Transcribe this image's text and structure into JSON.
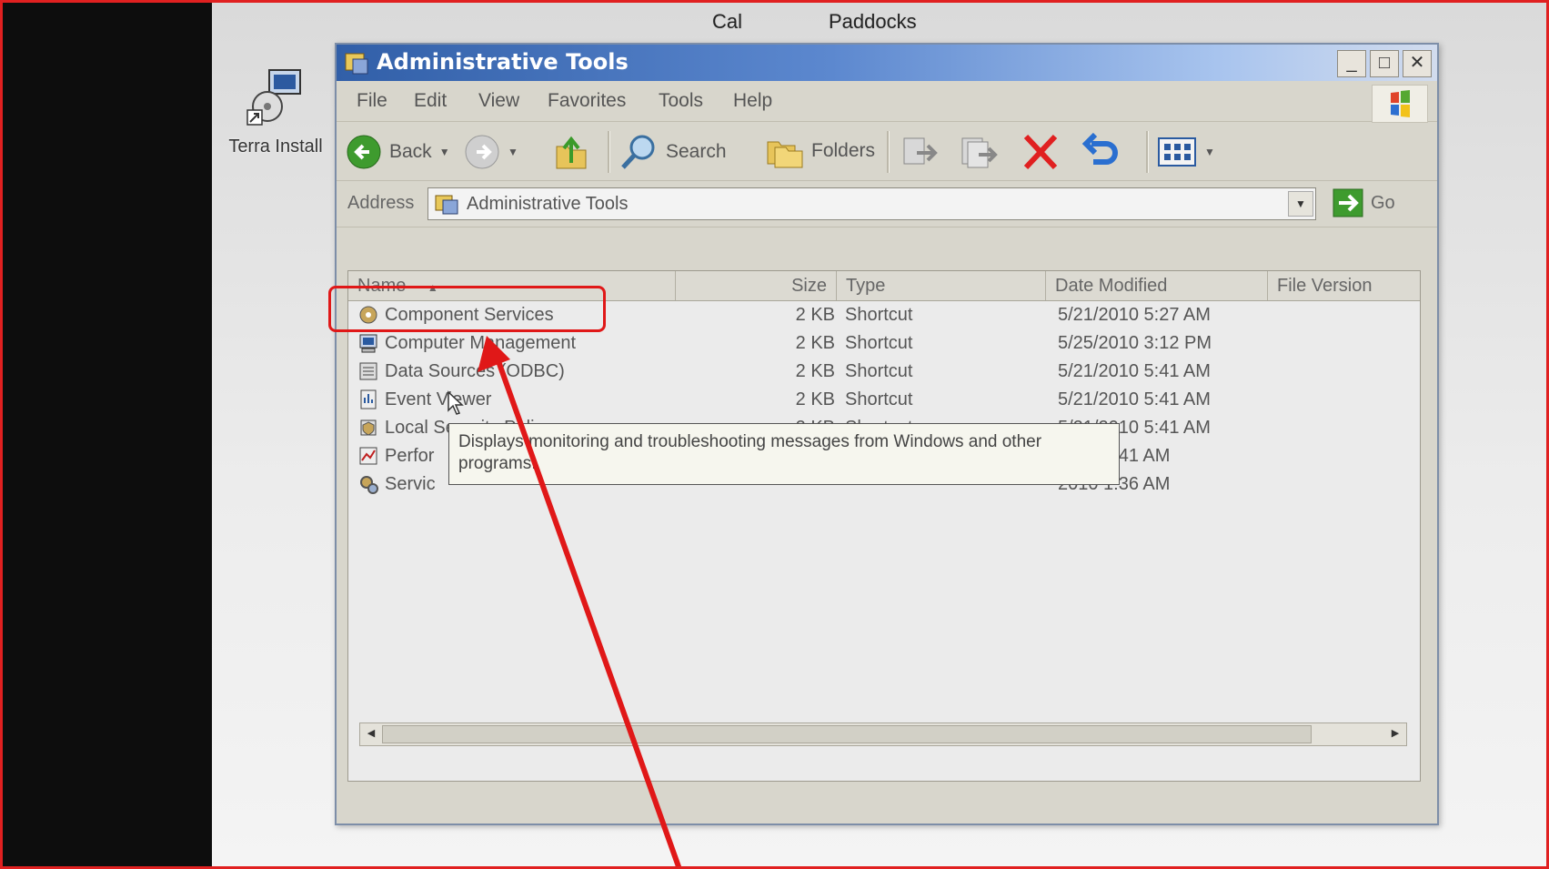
{
  "desktop": {
    "top_labels": [
      "Cal",
      "Paddocks"
    ],
    "icon_label": "Terra Install"
  },
  "window": {
    "title": "Administrative Tools",
    "controls": {
      "minimize": "_",
      "maximize": "□",
      "close": "✕"
    }
  },
  "menu": [
    "File",
    "Edit",
    "View",
    "Favorites",
    "Tools",
    "Help"
  ],
  "toolbar": {
    "back_label": "Back",
    "search_label": "Search",
    "folders_label": "Folders"
  },
  "address": {
    "label": "Address",
    "value": "Administrative Tools",
    "go_label": "Go"
  },
  "columns": [
    "Name",
    "Size",
    "Type",
    "Date Modified",
    "File Version"
  ],
  "rows": [
    {
      "name": "Component Services",
      "size": "2 KB",
      "type": "Shortcut",
      "date": "5/21/2010 5:27 AM"
    },
    {
      "name": "Computer Management",
      "size": "2 KB",
      "type": "Shortcut",
      "date": "5/25/2010 3:12 PM"
    },
    {
      "name": "Data Sources (ODBC)",
      "size": "2 KB",
      "type": "Shortcut",
      "date": "5/21/2010 5:41 AM"
    },
    {
      "name": "Event Viewer",
      "size": "2 KB",
      "type": "Shortcut",
      "date": "5/21/2010 5:41 AM"
    },
    {
      "name": "Local Security Policy",
      "size": "2 KB",
      "type": "Shortcut",
      "date": "5/21/2010 5:41 AM"
    },
    {
      "name": "Perfor",
      "size": "",
      "type": "",
      "date": "2010 5:41 AM"
    },
    {
      "name": "Servic",
      "size": "",
      "type": "",
      "date": "2010 1:36 AM"
    }
  ],
  "tooltip": "Displays monitoring and troubleshooting messages from Windows and other programs.",
  "colors": {
    "annotation": "#e01818",
    "title_bar": "#315fa8"
  }
}
